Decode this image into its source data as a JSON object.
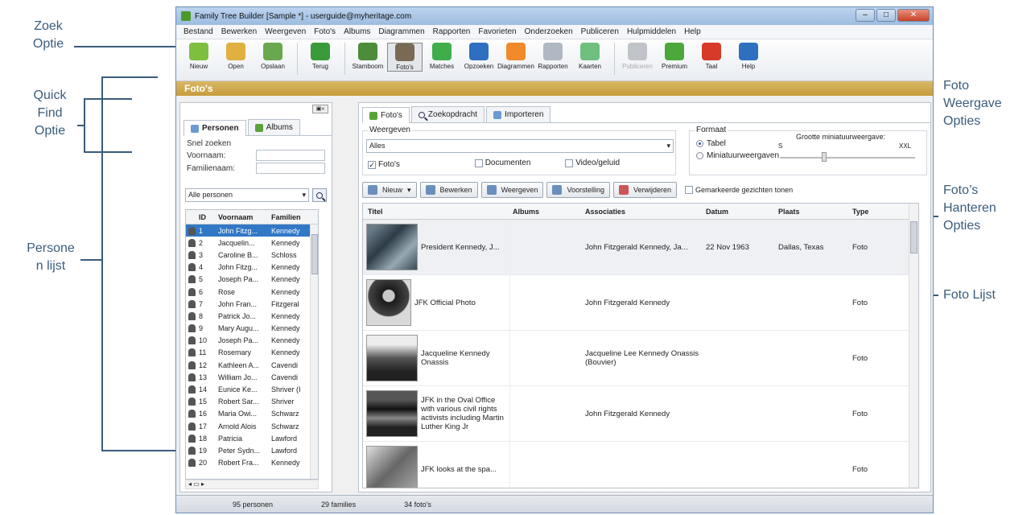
{
  "callouts": {
    "zoek": [
      "Zoek",
      "Optie"
    ],
    "quick": [
      "Quick",
      "Find",
      "Optie"
    ],
    "personen": [
      "Persone",
      "n lijst"
    ],
    "weergave": [
      "Foto",
      "Weergave",
      "Opties"
    ],
    "hanteren": [
      "Foto’s",
      "Hanteren",
      "Opties"
    ],
    "lijst": [
      "Foto Lijst"
    ]
  },
  "window": {
    "title": "Family Tree Builder [Sample *] - userguide@myheritage.com",
    "controls": [
      "–",
      "□",
      "✕"
    ]
  },
  "menu": [
    "Bestand",
    "Bewerken",
    "Weergeven",
    "Foto's",
    "Albums",
    "Diagrammen",
    "Rapporten",
    "Favorieten",
    "Onderzoeken",
    "Publiceren",
    "Hulpmiddelen",
    "Help"
  ],
  "toolbar": [
    {
      "label": "Nieuw",
      "color": "#7fbf3f"
    },
    {
      "label": "Open",
      "color": "#e0b040"
    },
    {
      "label": "Opslaan",
      "color": "#6aa84f"
    },
    {
      "label": "Terug",
      "color": "#3a9a3a"
    },
    {
      "label": "Stamboom",
      "color": "#4c8c3a"
    },
    {
      "label": "Foto's",
      "color": "#7a6a55",
      "active": true
    },
    {
      "label": "Matches",
      "color": "#3fae4a"
    },
    {
      "label": "Opzoeken",
      "color": "#2f6fc0"
    },
    {
      "label": "Diagrammen",
      "color": "#f08a2a"
    },
    {
      "label": "Rapporten",
      "color": "#b0b8c4"
    },
    {
      "label": "Kaarten",
      "color": "#6fbf7f"
    },
    {
      "label": "Publiceren",
      "color": "#c0c4c8",
      "dim": true
    },
    {
      "label": "Premium",
      "color": "#4ca83a"
    },
    {
      "label": "Taal",
      "color": "#d83a2a"
    },
    {
      "label": "Help",
      "color": "#2f6fc0"
    }
  ],
  "section_title": "Foto's",
  "left": {
    "tabs": [
      "Personen",
      "Albums"
    ],
    "quick_title": "Snel zoeken",
    "first_name_label": "Voornaam:",
    "last_name_label": "Familienaam:",
    "filter": "Alle personen",
    "columns": [
      "ID",
      "Voornaam",
      "Familien"
    ],
    "persons": [
      {
        "id": "1",
        "first": "John Fitzg...",
        "last": "Kennedy"
      },
      {
        "id": "2",
        "first": "Jacquelin...",
        "last": "Kennedy"
      },
      {
        "id": "3",
        "first": "Caroline B...",
        "last": "Schloss"
      },
      {
        "id": "4",
        "first": "John Fitzg...",
        "last": "Kennedy"
      },
      {
        "id": "5",
        "first": "Joseph Pa...",
        "last": "Kennedy"
      },
      {
        "id": "6",
        "first": "Rose",
        "last": "Kennedy"
      },
      {
        "id": "7",
        "first": "John Fran...",
        "last": "Fitzgeral"
      },
      {
        "id": "8",
        "first": "Patrick Jo...",
        "last": "Kennedy"
      },
      {
        "id": "9",
        "first": "Mary Augu...",
        "last": "Kennedy"
      },
      {
        "id": "10",
        "first": "Joseph Pa...",
        "last": "Kennedy"
      },
      {
        "id": "11",
        "first": "Rosemary",
        "last": "Kennedy"
      },
      {
        "id": "12",
        "first": "Kathleen A...",
        "last": "Cavendi"
      },
      {
        "id": "13",
        "first": "William Jo...",
        "last": "Cavendi"
      },
      {
        "id": "14",
        "first": "Eunice Ke...",
        "last": "Shriver (I"
      },
      {
        "id": "15",
        "first": "Robert Sar...",
        "last": "Shriver"
      },
      {
        "id": "16",
        "first": "Maria Owi...",
        "last": "Schwarz"
      },
      {
        "id": "17",
        "first": "Arnold Alois",
        "last": "Schwarz"
      },
      {
        "id": "18",
        "first": "Patricia",
        "last": "Lawford"
      },
      {
        "id": "19",
        "first": "Peter Sydn...",
        "last": "Lawford"
      },
      {
        "id": "20",
        "first": "Robert Fra...",
        "last": "Kennedy"
      }
    ]
  },
  "right": {
    "tabs": [
      "Foto's",
      "Zoekopdracht",
      "Importeren"
    ],
    "view_legend": "Weergeven",
    "view_value": "Alles",
    "checks": [
      "Foto's",
      "Documenten",
      "Video/geluid"
    ],
    "format_legend": "Formaat",
    "format_table": "Tabel",
    "format_thumbs": "Miniatuurweergaven",
    "thumb_size_label": "Grootte miniatuurweergave:",
    "thumb_size_min": "S",
    "thumb_size_max": "XXL",
    "actions": [
      "Nieuw",
      "Bewerken",
      "Weergeven",
      "Voorstelling",
      "Verwijderen"
    ],
    "show_marked": "Gemarkeerde gezichten tonen",
    "columns": [
      "Titel",
      "Albums",
      "Associaties",
      "Datum",
      "Plaats",
      "Type"
    ],
    "photos": [
      {
        "title": "President Kennedy, J...",
        "album": "",
        "assoc": "John Fitzgerald Kennedy, Ja...",
        "date": "22 Nov 1963",
        "place": "Dallas, Texas",
        "type": "Foto"
      },
      {
        "title": "JFK Official Photo",
        "album": "",
        "assoc": "John Fitzgerald Kennedy",
        "date": "",
        "place": "",
        "type": "Foto"
      },
      {
        "title": "Jacqueline Kennedy Onassis",
        "album": "",
        "assoc": "Jacqueline Lee Kennedy Onassis (Bouvier)",
        "date": "",
        "place": "",
        "type": "Foto"
      },
      {
        "title": "JFK in the Oval Office with various civil rights activists including Martin Luther King Jr",
        "album": "",
        "assoc": "John Fitzgerald Kennedy",
        "date": "",
        "place": "",
        "type": "Foto"
      },
      {
        "title": "JFK looks at the spa...",
        "album": "",
        "assoc": "",
        "date": "",
        "place": "",
        "type": "Foto"
      }
    ]
  },
  "status": [
    "95 personen",
    "29 families",
    "34 foto's"
  ]
}
